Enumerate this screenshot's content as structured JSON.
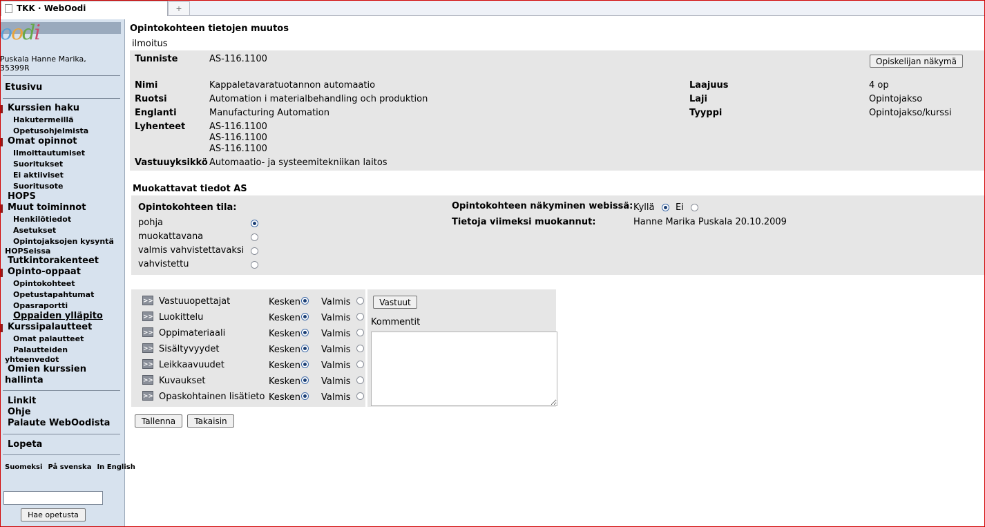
{
  "browser": {
    "tab_title": "TKK · WebOodi",
    "new_tab_symbol": "+"
  },
  "sidebar": {
    "logo": {
      "o1": "o",
      "o2": "o",
      "d": "d",
      "i": "i"
    },
    "user_line1": "Puskala Hanne Marika,",
    "user_line2": "35399R",
    "etusivu": "Etusivu",
    "kurssien_haku": "Kurssien haku",
    "hakutermeilla": "Hakutermeillä",
    "opetusohjelmista": "Opetusohjelmista",
    "omat_opinnot": "Omat opinnot",
    "ilmoittautumiset": "Ilmoittautumiset",
    "suoritukset": "Suoritukset",
    "ei_aktiiviset": "Ei aktiiviset",
    "suoritusote": "Suoritusote",
    "hops": "HOPS",
    "muut_toiminnot": "Muut toiminnot",
    "henkilotiedot": "Henkilötiedot",
    "asetukset": "Asetukset",
    "opintojaksojen_kysynta_1": "Opintojaksojen kysyntä",
    "opintojaksojen_kysynta_2": "HOPSeissa",
    "tutkintorakenteet": "Tutkintorakenteet",
    "opinto_oppaat": "Opinto-oppaat",
    "opintokohteet": "Opintokohteet",
    "opetustapahtumat": "Opetustapahtumat",
    "opasraportti": "Opasraportti",
    "oppaiden_yllapito": "Oppaiden ylläpito",
    "kurssipalautteet": "Kurssipalautteet",
    "omat_palautteet": "Omat palautteet",
    "palautteiden_1": "Palautteiden",
    "palautteiden_2": "yhteenvedot",
    "omien_kurssien_1": "Omien kurssien",
    "omien_kurssien_2": "hallinta",
    "linkit": "Linkit",
    "ohje": "Ohje",
    "palaute": "Palaute WebOodista",
    "lopeta": "Lopeta",
    "lang_fi": "Suomeksi",
    "lang_sv": "På svenska",
    "lang_en": "In English",
    "search_value": "",
    "search_button": "Hae opetusta"
  },
  "main": {
    "title": "Opintokohteen tietojen muutos",
    "subhead": "ilmoitus",
    "info": {
      "tunniste_label": "Tunniste",
      "tunniste_value": "AS-116.1100",
      "opiskelijan_nakyma": "Opiskelijan näkymä",
      "nimi_label": "Nimi",
      "nimi_value": "Kappaletavaratuotannon automaatio",
      "ruotsi_label": "Ruotsi",
      "ruotsi_value": "Automation i materialbehandling och produktion",
      "englanti_label": "Englanti",
      "englanti_value": "Manufacturing Automation",
      "lyhenteet_label": "Lyhenteet",
      "lyhenteet": [
        "AS-116.1100",
        "AS-116.1100",
        "AS-116.1100"
      ],
      "vastuuyksikko_label": "Vastuuyksikkö",
      "vastuuyksikko_value": "Automaatio- ja systeemitekniikan laitos",
      "laajuus_label": "Laajuus",
      "laajuus_value": "4 op",
      "laji_label": "Laji",
      "laji_value": "Opintojakso",
      "tyyppi_label": "Tyyppi",
      "tyyppi_value": "Opintojakso/kurssi"
    },
    "editable_title": "Muokattavat tiedot AS",
    "editable": {
      "tila_label": "Opintokohteen tila:",
      "tila_options": [
        "pohja",
        "muokattavana",
        "valmis vahvistettavaksi",
        "vahvistettu"
      ],
      "tila_selected": "pohja",
      "nakyminen_label": "Opintokohteen näkyminen webissä:",
      "kylla": "Kyllä",
      "ei": "Ei",
      "nakyminen_selected": "Kyllä",
      "muokannut_label": "Tietoja viimeksi muokannut:",
      "muokannut_value": "Hanne Marika Puskala 20.10.2009"
    },
    "sections": {
      "expander": ">>",
      "kesken": "Kesken",
      "valmis": "Valmis",
      "items": [
        {
          "label": "Vastuuopettajat",
          "selected": "Kesken"
        },
        {
          "label": "Luokittelu",
          "selected": "Kesken"
        },
        {
          "label": "Oppimateriaali",
          "selected": "Kesken"
        },
        {
          "label": "Sisältyvyydet",
          "selected": "Kesken"
        },
        {
          "label": "Leikkaavuudet",
          "selected": "Kesken"
        },
        {
          "label": "Kuvaukset",
          "selected": "Kesken"
        },
        {
          "label": "Opaskohtainen lisätieto",
          "selected": "Kesken"
        }
      ]
    },
    "vastuut_button": "Vastuut",
    "kommentit_label": "Kommentit",
    "kommentit_value": "",
    "tallenna_button": "Tallenna",
    "takaisin_button": "Takaisin"
  }
}
